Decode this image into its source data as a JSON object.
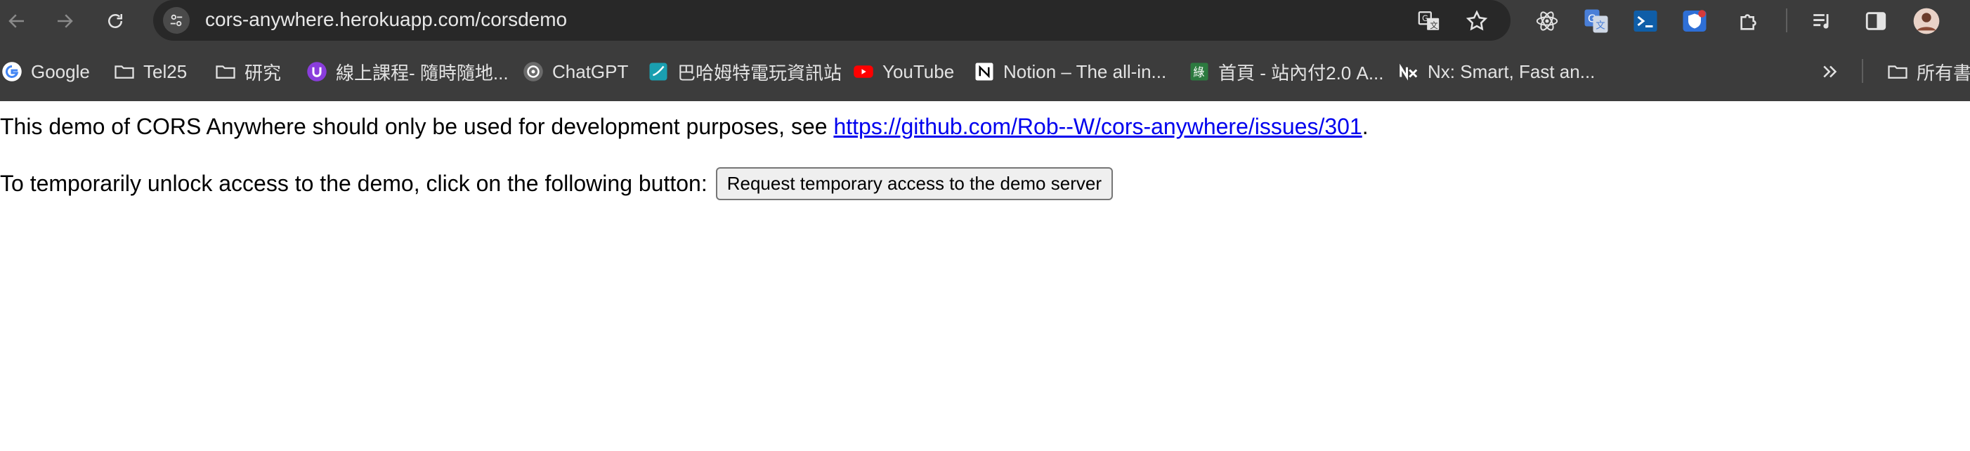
{
  "browser": {
    "url": "cors-anywhere.herokuapp.com/corsdemo",
    "nav": {
      "back_icon": "arrow-left-icon",
      "forward_icon": "arrow-right-icon",
      "reload_icon": "reload-icon"
    },
    "omnibox_icons": [
      "translate-icon",
      "star-icon"
    ],
    "extensions": [
      "react-devtools-icon",
      "google-translate-icon",
      "terminal-icon",
      "shield-extension-icon",
      "puzzle-extensions-icon",
      "reading-list-icon",
      "side-panel-icon",
      "profile-avatar"
    ]
  },
  "bookmarks": {
    "items": [
      {
        "label": "Google",
        "icon": "google-icon"
      },
      {
        "label": "Tel25",
        "icon": "folder-icon"
      },
      {
        "label": "研究",
        "icon": "folder-icon"
      },
      {
        "label": "線上課程- 隨時隨地...",
        "icon": "course-site-icon"
      },
      {
        "label": "ChatGPT",
        "icon": "chatgpt-icon"
      },
      {
        "label": "巴哈姆特電玩資訊站",
        "icon": "bahamut-icon"
      },
      {
        "label": "YouTube",
        "icon": "youtube-icon"
      },
      {
        "label": "Notion – The all-in...",
        "icon": "notion-icon"
      },
      {
        "label": "首頁 - 站內付2.0 A...",
        "icon": "site-icon"
      },
      {
        "label": "Nx: Smart, Fast an...",
        "icon": "nx-icon"
      }
    ],
    "overflow_icon": "chevron-double-right-icon",
    "all_bookmarks_label": "所有書"
  },
  "page": {
    "line1_prefix": "This demo of CORS Anywhere should only be used for development purposes, see ",
    "link_text": "https://github.com/Rob--W/cors-anywhere/issues/301",
    "line1_suffix": ".",
    "line2_text": "To temporarily unlock access to the demo, click on the following button: ",
    "button_label": "Request temporary access to the demo server"
  },
  "colors": {
    "toolbar_bg": "#3c3c3c",
    "omnibox_bg": "#282828",
    "link": "#0000ee"
  }
}
